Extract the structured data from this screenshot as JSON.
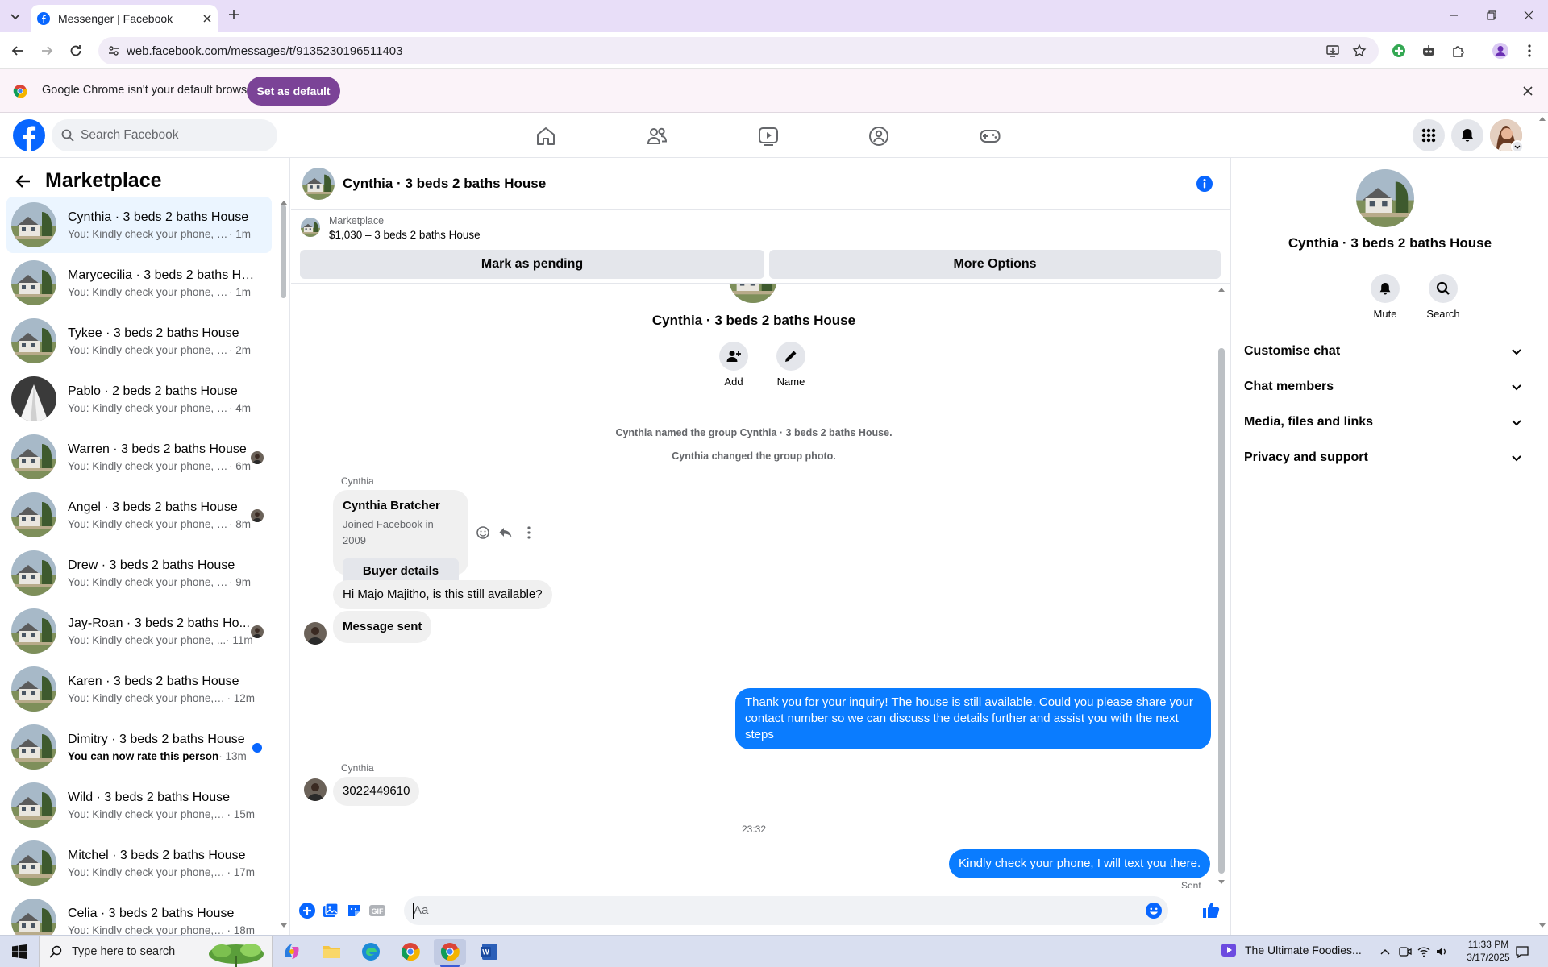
{
  "browser": {
    "tab_title": "Messenger | Facebook",
    "url": "web.facebook.com/messages/t/9135230196511403",
    "infobar_text": "Google Chrome isn't your default browser",
    "set_default_label": "Set as default"
  },
  "facebook": {
    "search_placeholder": "Search Facebook"
  },
  "sidebar": {
    "title": "Marketplace",
    "conversations": [
      {
        "name": "Cynthia · 3 beds 2 baths House",
        "preview": "You: Kindly check your phone, I wil...",
        "time": "· 1m"
      },
      {
        "name": "Marycecilia · 3 beds 2 baths Hou...",
        "preview": "You: Kindly check your phone, I wil...",
        "time": "· 1m"
      },
      {
        "name": "Tykee · 3 beds 2 baths House",
        "preview": "You: Kindly check your phone, I wil...",
        "time": "· 2m"
      },
      {
        "name": "Pablo · 2 beds 2 baths House",
        "preview": "You: Kindly check your phone, I wil...",
        "time": "· 4m"
      },
      {
        "name": "Warren · 3 beds 2 baths House",
        "preview": "You: Kindly check your phone, I ...",
        "time": "· 6m"
      },
      {
        "name": "Angel · 3 beds 2 baths House",
        "preview": "You: Kindly check your phone, I ...",
        "time": "· 8m"
      },
      {
        "name": "Drew · 3 beds 2 baths House",
        "preview": "You: Kindly check your phone, I wil...",
        "time": "· 9m"
      },
      {
        "name": "Jay-Roan · 3 beds 2 baths Ho...",
        "preview": "You: Kindly check your phone, ...",
        "time": "· 11m"
      },
      {
        "name": "Karen · 3 beds 2 baths House",
        "preview": "You: Kindly check your phone, I w...",
        "time": "· 12m"
      },
      {
        "name": "Dimitry · 3 beds 2 baths House",
        "preview": "You can now rate this person",
        "time": " · 13m"
      },
      {
        "name": "Wild · 3 beds 2 baths House",
        "preview": "You: Kindly check your phone, I w...",
        "time": "· 15m"
      },
      {
        "name": "Mitchel · 3 beds 2 baths House",
        "preview": "You: Kindly check your phone, I w...",
        "time": "· 17m"
      },
      {
        "name": "Celia · 3 beds 2 baths House",
        "preview": "You: Kindly check your phone, I w...",
        "time": "· 18m"
      }
    ]
  },
  "chat": {
    "title": "Cynthia · 3 beds 2 baths House",
    "marketplace_label": "Marketplace",
    "listing": "$1,030 – 3 beds 2 baths House",
    "mark_pending": "Mark as pending",
    "more_options": "More Options",
    "group_name": "Cynthia · 3 beds 2 baths House",
    "add_label": "Add",
    "name_label": "Name",
    "sys1": "Cynthia named the group Cynthia · 3 beds 2 baths House.",
    "sys2": "Cynthia changed the group photo.",
    "sender": "Cynthia",
    "card_name": "Cynthia Bratcher",
    "card_sub": "Joined Facebook in 2009",
    "buyer_details": "Buyer details",
    "msg_question": "Hi Majo Majitho, is this still available?",
    "msg_sent_card": "Message sent",
    "msg_reply": "Thank you for your inquiry! The house is still available. Could you please share your contact number so we can discuss the details further and assist you with the next steps",
    "msg_number": "3022449610",
    "timestamp": "23:32",
    "msg_last": "Kindly check your phone, I will text you there.",
    "status": "Sent",
    "composer_placeholder": "Aa"
  },
  "details": {
    "title": "Cynthia · 3 beds 2 baths House",
    "mute": "Mute",
    "search": "Search",
    "sections": [
      "Customise chat",
      "Chat members",
      "Media, files and links",
      "Privacy and support"
    ]
  },
  "taskbar": {
    "search_placeholder": "Type here to search",
    "media_title": "The Ultimate Foodies...",
    "time": "11:33 PM",
    "date": "3/17/2025"
  },
  "colors": {
    "accent": "#0866ff",
    "bubble_me": "#0a7cff",
    "messenger_blue": "#0084ff"
  }
}
